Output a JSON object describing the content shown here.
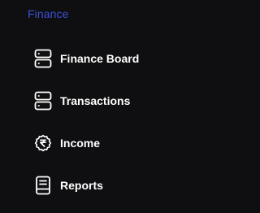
{
  "section": {
    "title": "Finance"
  },
  "menu": {
    "items": [
      {
        "label": "Finance Board",
        "icon": "server-icon"
      },
      {
        "label": "Transactions",
        "icon": "server-icon"
      },
      {
        "label": "Income",
        "icon": "rupee-coin-icon"
      },
      {
        "label": "Reports",
        "icon": "report-document-icon"
      }
    ]
  },
  "colors": {
    "background": "#0f0f11",
    "section_title": "#3b4fd8",
    "item_text": "#ffffff"
  }
}
